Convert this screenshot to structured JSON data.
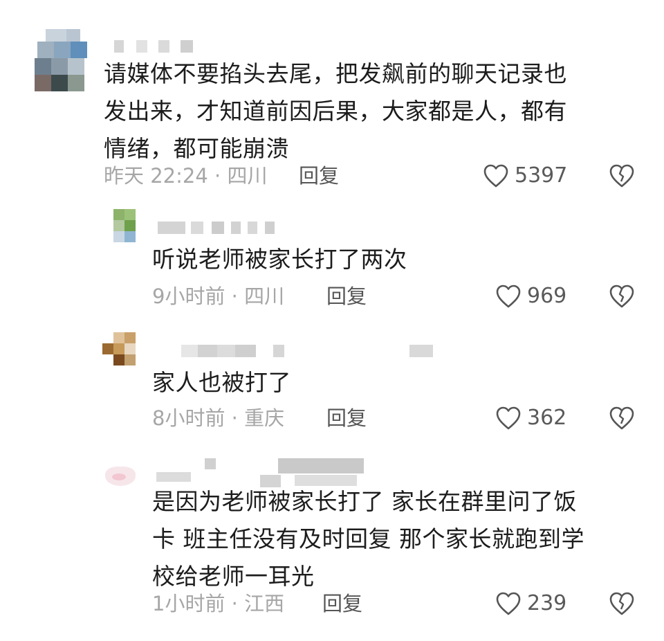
{
  "comments": [
    {
      "text_lines": [
        "请媒体不要掐头去尾，把发飙前的聊天记录也",
        "发出来，才知道前因后果，大家都是人，都有",
        "情绪，都可能崩溃"
      ],
      "meta": "昨天 22:24 · 四川",
      "reply_label": "回复",
      "likes": "5397"
    },
    {
      "text_lines": [
        "听说老师被家长打了两次"
      ],
      "meta": "9小时前 · 四川",
      "reply_label": "回复",
      "likes": "969"
    },
    {
      "text_lines": [
        "家人也被打了"
      ],
      "meta": "8小时前 · 重庆",
      "reply_label": "回复",
      "likes": "362"
    },
    {
      "text_lines": [
        "是因为老师被家长打了 家长在群里问了饭",
        "卡 班主任没有及时回复 那个家长就跑到学",
        "校给老师一耳光"
      ],
      "meta": "1小时前 · 江西",
      "reply_label": "回复",
      "likes": "239"
    }
  ],
  "icons": {
    "like": "heart-outline-icon",
    "dislike": "broken-heart-icon"
  },
  "colors": {
    "text": "#1c1c1c",
    "meta": "#a6a6a6",
    "icon": "#555555"
  }
}
